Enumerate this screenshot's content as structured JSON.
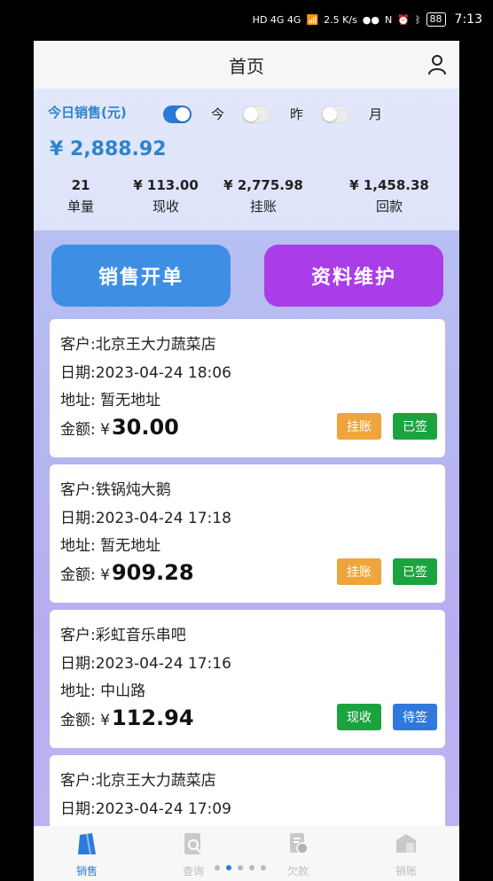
{
  "status_bar": {
    "network": "HD 4G 4G",
    "speed": "2.5 K/s",
    "battery": "88",
    "time": "7:13"
  },
  "header": {
    "title": "首页"
  },
  "summary": {
    "label": "今日销售(元)",
    "toggles": [
      {
        "label": "今",
        "on": true
      },
      {
        "label": "昨",
        "on": false
      },
      {
        "label": "月",
        "on": false
      }
    ],
    "total": "¥ 2,888.92",
    "stats": [
      {
        "value": "21",
        "label": "单量"
      },
      {
        "value": "¥ 113.00",
        "label": "现收"
      },
      {
        "value": "¥ 2,775.98",
        "label": "挂账"
      },
      {
        "value": "¥ 1,458.38",
        "label": "回款"
      }
    ]
  },
  "actions": {
    "sale": "销售开单",
    "data": "资料维护"
  },
  "orders": [
    {
      "customer": "客户:北京王大力蔬菜店",
      "date": "日期:2023-04-24 18:06",
      "address": "地址: 暂无地址",
      "amount_label": "金额: ¥",
      "amount": "30.00",
      "tag1": "挂账",
      "tag2": "已签"
    },
    {
      "customer": "客户:铁锅炖大鹅",
      "date": "日期:2023-04-24 17:18",
      "address": "地址: 暂无地址",
      "amount_label": "金额: ¥",
      "amount": "909.28",
      "tag1": "挂账",
      "tag2": "已签"
    },
    {
      "customer": "客户:彩虹音乐串吧",
      "date": "日期:2023-04-24 17:16",
      "address": "地址: 中山路",
      "amount_label": "金额: ¥",
      "amount": "112.94",
      "tag1": "现收",
      "tag2": "待签"
    },
    {
      "customer": "客户:北京王大力蔬菜店",
      "date": "日期:2023-04-24 17:09"
    }
  ],
  "tabs": [
    {
      "label": "销售",
      "icon": "bag-icon",
      "active": true
    },
    {
      "label": "查询",
      "icon": "search-doc-icon",
      "active": false
    },
    {
      "label": "欠款",
      "icon": "debt-icon",
      "active": false
    },
    {
      "label": "销账",
      "icon": "writeoff-icon",
      "active": false
    }
  ],
  "colors": {
    "accent_blue": "#2e79db",
    "purple": "#ab3de8",
    "orange": "#f0a43c",
    "green": "#1aa33f"
  }
}
